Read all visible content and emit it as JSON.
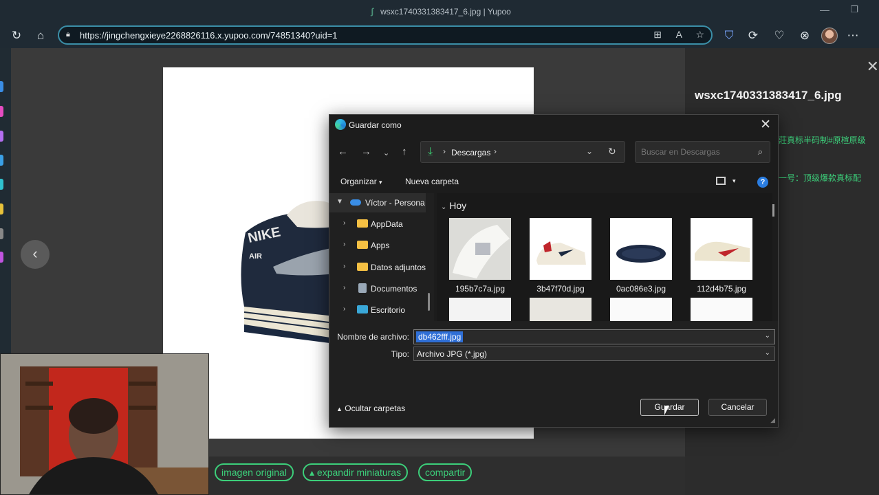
{
  "browser": {
    "tab_title": "wsxc1740331383417_6.jpg | Yupoo",
    "url": "https://jingchengxieye2268826116.x.yupoo.com/74851340?uid=1"
  },
  "viewer": {
    "image_title": "wsxc1740331383417_6.jpg",
    "side_text_lines": [
      "莊真标半码制#原楦原级",
      "一号：顶级爆款真标配"
    ],
    "actions": [
      "imagen original",
      "expandir miniaturas",
      "compartir"
    ]
  },
  "dialog": {
    "title": "Guardar como",
    "breadcrumb": "Descargas",
    "search_placeholder": "Buscar en Descargas",
    "commands": {
      "organize": "Organizar",
      "new_folder": "Nueva carpeta"
    },
    "tree": [
      {
        "label": "Víctor - Persona",
        "type": "cloud",
        "expanded": true
      },
      {
        "label": "AppData",
        "type": "folder"
      },
      {
        "label": "Apps",
        "type": "folder"
      },
      {
        "label": "Datos adjuntos",
        "type": "folder"
      },
      {
        "label": "Documentos",
        "type": "doc"
      },
      {
        "label": "Escritorio",
        "type": "desktop"
      }
    ],
    "group_header": "Hoy",
    "files": [
      {
        "name": "195b7c7a.jpg"
      },
      {
        "name": "3b47f70d.jpg"
      },
      {
        "name": "0ac086e3.jpg"
      },
      {
        "name": "112d4b75.jpg"
      }
    ],
    "filename_label": "Nombre de archivo:",
    "filename_value": "db462fff.jpg",
    "type_label": "Tipo:",
    "type_value": "Archivo JPG (*.jpg)",
    "hide_folders": "Ocultar carpetas",
    "save_button": "Guardar",
    "cancel_button": "Cancelar"
  },
  "colors": {
    "accent_green": "#3ccf7a",
    "url_border": "#3b8fa8",
    "selection_blue": "#2f6fd6"
  }
}
